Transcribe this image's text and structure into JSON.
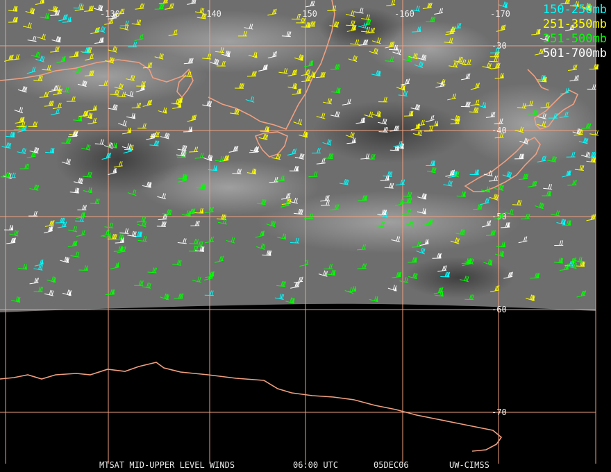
{
  "legend": [
    {
      "label": "150-250mb",
      "color": "#00ffff"
    },
    {
      "label": "251-350mb",
      "color": "#ffff00"
    },
    {
      "label": "351-500mb",
      "color": "#00ff00"
    },
    {
      "label": "501-700mb",
      "color": "#ffffff"
    }
  ],
  "longitude_labels": [
    "-130",
    "-140",
    "-150",
    "-160",
    "-170"
  ],
  "latitude_labels": [
    "-30",
    "-40",
    "-50",
    "-60",
    "-70"
  ],
  "caption": {
    "product": "MTSAT MID-UPPER LEVEL WINDS",
    "time": "06:00 UTC",
    "date": "05DEC06",
    "source": "UW-CIMSS"
  },
  "colors": {
    "grid": "#f0a080",
    "coastline": "#f0a080",
    "no_data": "#000000"
  }
}
